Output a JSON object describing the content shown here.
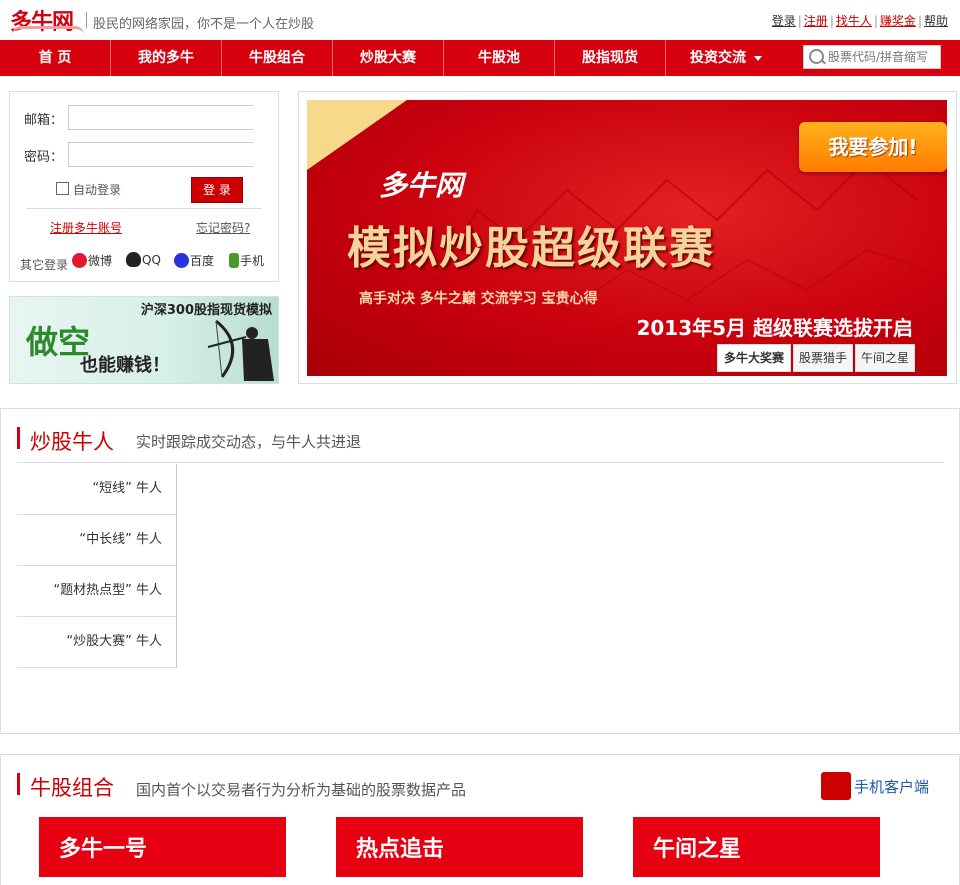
{
  "header": {
    "logo": "多牛网",
    "tagline": "股民的网络家园，你不是一个人在炒股",
    "links": [
      {
        "label": "登录",
        "red": false
      },
      {
        "label": "注册",
        "red": true
      },
      {
        "label": "找牛人",
        "red": true
      },
      {
        "label": "赚奖金",
        "red": true
      },
      {
        "label": "帮助",
        "red": false
      }
    ]
  },
  "nav": {
    "items": [
      "首 页",
      "我的多牛",
      "牛股组合",
      "炒股大赛",
      "牛股池",
      "股指现货",
      "投资交流"
    ],
    "search_placeholder": "股票代码/拼音缩写"
  },
  "login": {
    "email_label": "邮箱：",
    "password_label": "密码：",
    "auto_login": "自动登录",
    "login_button": "登 录",
    "register": "注册多牛账号",
    "forgot": "忘记密码?",
    "other_login": "其它登录",
    "providers": [
      {
        "label": "微博",
        "color": "#e6162d"
      },
      {
        "label": "QQ",
        "color": "#222222"
      },
      {
        "label": "百度",
        "color": "#2932e1"
      },
      {
        "label": "手机",
        "color": "#4a9a2a"
      }
    ]
  },
  "promo": {
    "top": "沪深300股指现货模拟",
    "big": "做空",
    "sub": "也能赚钱！"
  },
  "banner": {
    "brand": "多牛网",
    "title": "模拟炒股超级联赛",
    "subtitle": "高手对决  多牛之巅  交流学习  宝贵心得",
    "date": "2013年5月  超级联赛选拔开启",
    "join": "我要参加!",
    "tabs": [
      "多牛大奖赛",
      "股票猎手",
      "午间之星"
    ]
  },
  "section1": {
    "title": "炒股牛人",
    "desc": "实时跟踪成交动态，与牛人共进退",
    "menu": [
      "“短线” 牛人",
      "“中长线” 牛人",
      "“题材热点型” 牛人",
      "“炒股大赛” 牛人"
    ]
  },
  "section2": {
    "title": "牛股组合",
    "desc": "国内首个以交易者行为分析为基础的股票数据产品",
    "mobile": "手机客户端",
    "cards": [
      "多牛一号",
      "热点追击",
      "午间之星"
    ]
  },
  "colors": {
    "brand_red": "#d7000f",
    "link_blue": "#1a5aa8"
  }
}
